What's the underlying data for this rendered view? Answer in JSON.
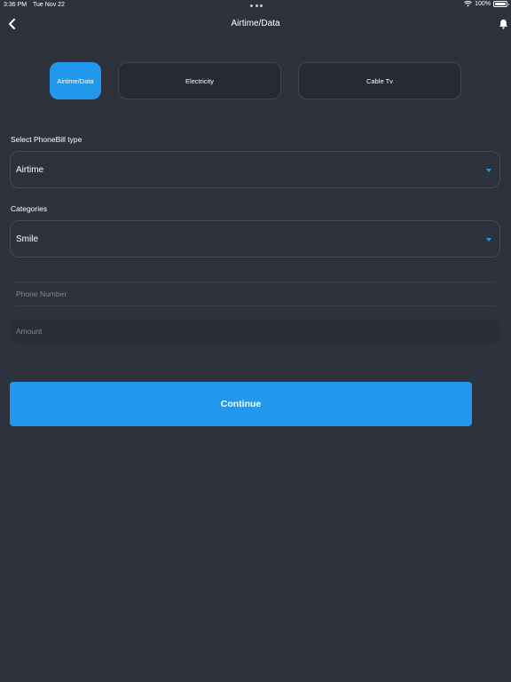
{
  "status_bar": {
    "time": "3:36 PM",
    "date": "Tue Nov 22",
    "battery": "100%"
  },
  "header": {
    "title": "Airtime/Data"
  },
  "tabs": [
    {
      "label": "Airtime/Data",
      "active": true
    },
    {
      "label": "Electricity",
      "active": false
    },
    {
      "label": "Cable Tv",
      "active": false
    }
  ],
  "form": {
    "phonebill_type": {
      "label": "Select PhoneBill type",
      "value": "Airtime"
    },
    "categories": {
      "label": "Categories",
      "value": "Smile"
    },
    "phone_number": {
      "placeholder": "Phone Number",
      "value": ""
    },
    "amount": {
      "placeholder": "Amount",
      "value": ""
    }
  },
  "continue_label": "Continue",
  "colors": {
    "background": "#2e323d",
    "accent": "#2298ec",
    "tab_inactive": "#262a34"
  }
}
